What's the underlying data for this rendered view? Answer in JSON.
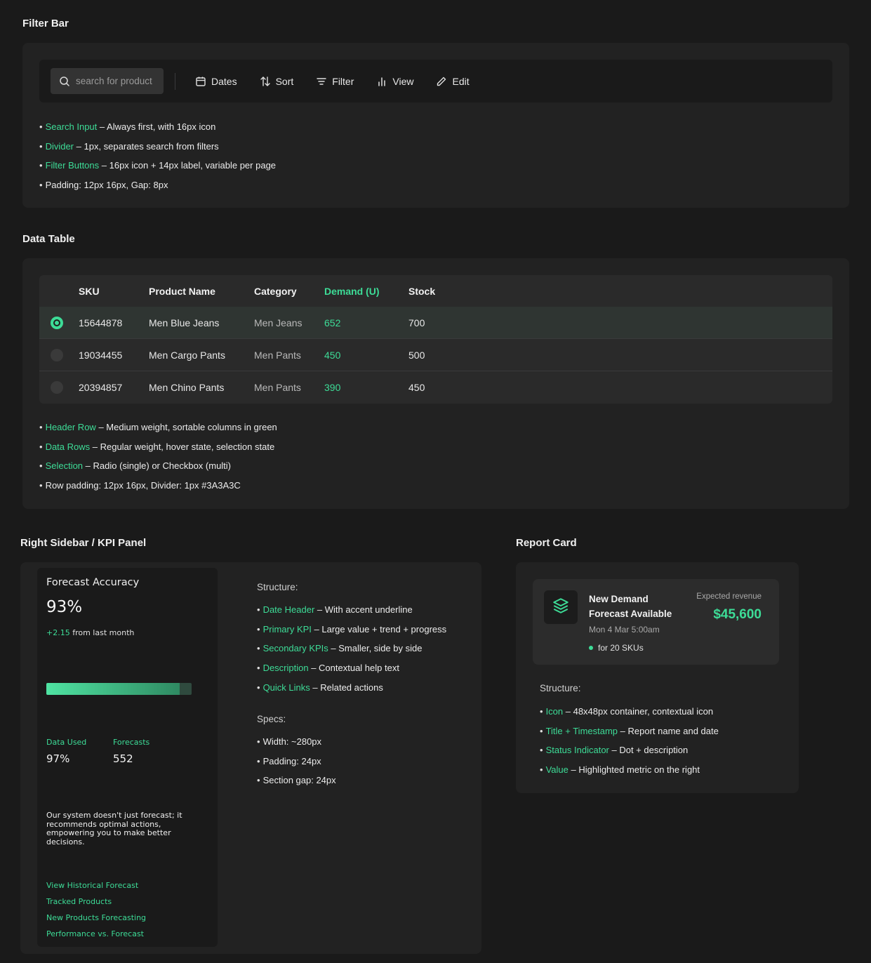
{
  "filter_section": {
    "title": "Filter Bar",
    "search_placeholder": "search for product",
    "buttons": [
      {
        "label": "Dates",
        "icon": "calendar-icon"
      },
      {
        "label": "Sort",
        "icon": "sort-arrows-icon"
      },
      {
        "label": "Filter",
        "icon": "filter-lines-icon"
      },
      {
        "label": "View",
        "icon": "bar-chart-icon"
      },
      {
        "label": "Edit",
        "icon": "pencil-icon"
      }
    ],
    "notes": [
      {
        "term": "Search Input",
        "text": " – Always first, with 16px icon"
      },
      {
        "term": "Divider",
        "text": " – 1px, separates search from filters"
      },
      {
        "term": "Filter Buttons",
        "text": " – 16px icon + 14px label, variable per page"
      },
      {
        "term": "",
        "text": "Padding: 12px 16px, Gap: 8px"
      }
    ]
  },
  "table_section": {
    "title": "Data Table",
    "headers": {
      "sku": "SKU",
      "name": "Product Name",
      "category": "Category",
      "demand": "Demand (U)",
      "stock": "Stock"
    },
    "rows": [
      {
        "sku": "15644878",
        "name": "Men Blue Jeans",
        "category": "Men Jeans",
        "demand": "652",
        "stock": "700",
        "selected": true
      },
      {
        "sku": "19034455",
        "name": "Men Cargo Pants",
        "category": "Men Pants",
        "demand": "450",
        "stock": "500",
        "selected": false
      },
      {
        "sku": "20394857",
        "name": "Men Chino Pants",
        "category": "Men Pants",
        "demand": "390",
        "stock": "450",
        "selected": false
      }
    ],
    "notes": [
      {
        "term": "Header Row",
        "text": " – Medium weight, sortable columns in green"
      },
      {
        "term": "Data Rows",
        "text": " – Regular weight, hover state, selection state"
      },
      {
        "term": "Selection",
        "text": " – Radio (single) or Checkbox (multi)"
      },
      {
        "term": "",
        "text": "Row padding: 12px 16px, Divider: 1px #3A3A3C"
      }
    ]
  },
  "kpi_section": {
    "title": "Right Sidebar / KPI Panel",
    "card": {
      "heading": "Forecast Accuracy",
      "value": "93%",
      "trend_value": "+2.15",
      "trend_text": " from last month",
      "progress_fraction": 0.92,
      "secondary": [
        {
          "label": "Data Used",
          "value": "97%"
        },
        {
          "label": "Forecasts",
          "value": "552"
        }
      ],
      "description": "Our system doesn't just forecast; it recommends optimal actions, empowering you to make better decisions.",
      "links": [
        "View Historical Forecast",
        "Tracked Products",
        "New Products Forecasting",
        "Performance vs. Forecast"
      ]
    },
    "structure_title": "Structure:",
    "structure": [
      {
        "term": "Date Header",
        "text": " – With accent underline"
      },
      {
        "term": "Primary KPI",
        "text": " – Large value + trend + progress"
      },
      {
        "term": "Secondary KPIs",
        "text": " – Smaller, side by side"
      },
      {
        "term": "Description",
        "text": " – Contextual help text"
      },
      {
        "term": "Quick Links",
        "text": " – Related actions"
      }
    ],
    "specs_title": "Specs:",
    "specs": [
      "Width: ~280px",
      "Padding: 24px",
      "Section gap: 24px"
    ]
  },
  "report_section": {
    "title": "Report Card",
    "card": {
      "icon": "layers-icon",
      "title_line1": "New Demand",
      "title_line2": "Forecast Available",
      "timestamp": "Mon 4 Mar 5:00am",
      "status": "for 20 SKUs",
      "value_label": "Expected revenue",
      "value": "$45,600"
    },
    "structure_title": "Structure:",
    "structure": [
      {
        "term": "Icon",
        "text": " – 48x48px container, contextual icon"
      },
      {
        "term": "Title + Timestamp",
        "text": " – Report name and date"
      },
      {
        "term": "Status Indicator",
        "text": " – Dot + description"
      },
      {
        "term": "Value",
        "text": " – Highlighted metric on the right"
      }
    ]
  },
  "colors": {
    "accent": "#3ddc97",
    "background": "#1a1a1a",
    "panel": "#222222",
    "divider": "#3a3a3c"
  }
}
